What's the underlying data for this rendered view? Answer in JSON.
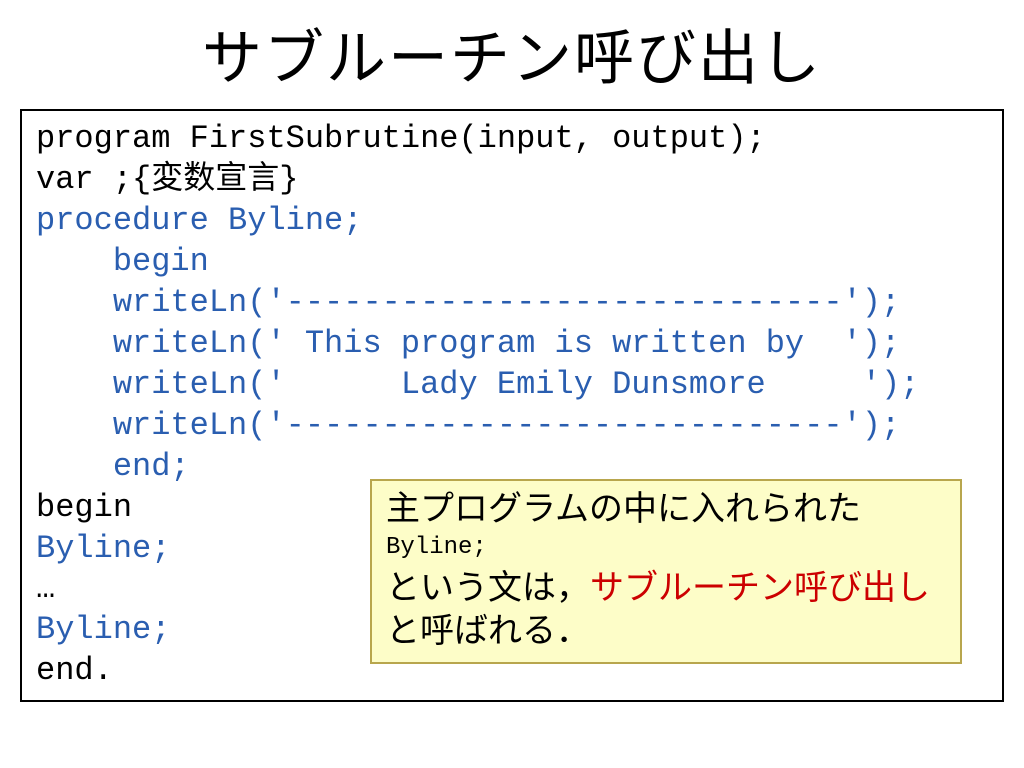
{
  "title": "サブルーチン呼び出し",
  "code": {
    "l1": "program FirstSubrutine(input, output);",
    "l2": "var ;{変数宣言}",
    "l3": "procedure Byline;",
    "l4": "    begin",
    "l5": "    writeLn('-----------------------------');",
    "l6": "    writeLn(' This program is written by  ');",
    "l7": "    writeLn('      Lady Emily Dunsmore     ');",
    "l8": "    writeLn('-----------------------------');",
    "l9": "    end;",
    "l10": "begin",
    "l11": "Byline;",
    "l12": "…",
    "l13": "Byline;",
    "l14": "end."
  },
  "callout": {
    "line1": "主プログラムの中に入れられた",
    "codeLine": "Byline;",
    "line2a": "という文は，",
    "line2b_red": "サブルーチン呼び出し",
    "line2c": "と呼ばれる．"
  }
}
